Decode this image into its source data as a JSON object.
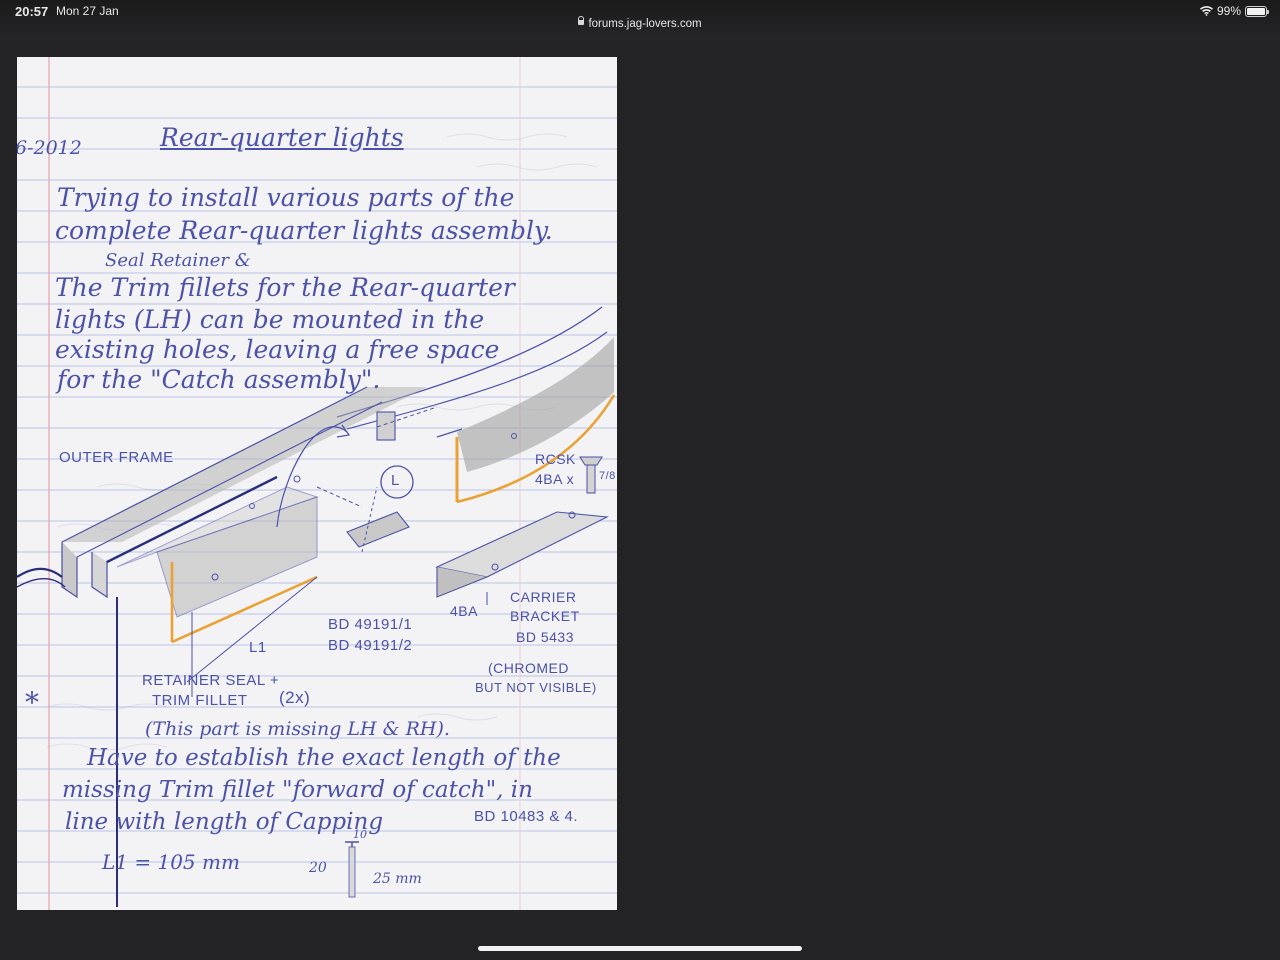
{
  "status_bar": {
    "time": "20:57",
    "date": "Mon 27 Jan",
    "url": "forums.jag-lovers.com",
    "battery": "99%"
  },
  "notebook": {
    "date": "6-2012",
    "title": "Rear-quarter lights",
    "intro_line1": "Trying to install various parts of the",
    "intro_line2": "complete Rear-quarter lights assembly.",
    "seal_line": "Seal Retainer &",
    "body_line1": "The Trim fillets for the Rear-quarter",
    "body_line2": "lights (LH) can be mounted in the",
    "body_line3": "existing holes, leaving a free space",
    "body_line4": "for the \"Catch assembly\".",
    "outer_frame": "OUTER FRAME",
    "label_L": "L",
    "rcsk_line1": "RCSK",
    "rcsk_line2": "4BA x",
    "rcsk_size": "7/8",
    "label_4ba": "4BA",
    "carrier_line1": "CARRIER",
    "carrier_line2": "BRACKET",
    "carrier_line3": "BD 5433",
    "bd_line1": "BD 49191/1",
    "bd_line2": "BD 49191/2",
    "label_L1": "L1",
    "chromed_line1": "(CHROMED",
    "chromed_line2": "BUT NOT VISIBLE)",
    "retainer_line1": "RETAINER SEAL +",
    "retainer_line2": "TRIM FILLET",
    "retainer_count": "(2x)",
    "asterisk": "*",
    "missing_line": "(This part is missing LH & RH).",
    "establish_line1": "Have to establish the exact length of the",
    "establish_line2": "missing Trim fillet \"forward of catch\", in",
    "establish_line3": "line with length of Capping",
    "capping_part": "BD 10483 & 4.",
    "measure_L1": "L1 = 105 mm",
    "dim_10": "10",
    "dim_20": "20",
    "dim_25": "25 mm"
  },
  "colors": {
    "ink": "#4b52a8",
    "pencil": "#8a8a8a",
    "highlight": "#e9a233",
    "page": "#f3f2f4",
    "rule_line": "#b9c6e8",
    "margin_line": "#e9a7b3"
  }
}
